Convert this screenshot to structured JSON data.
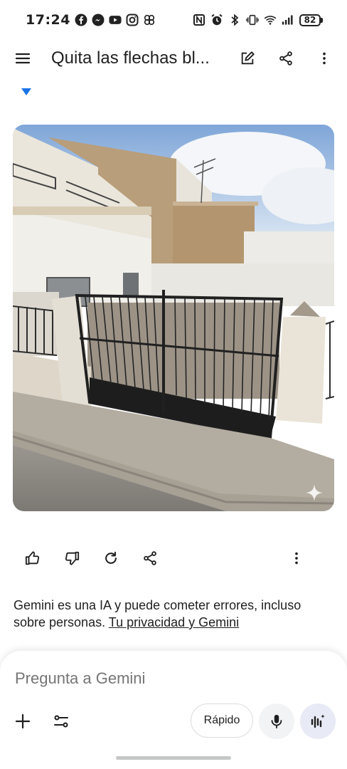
{
  "status_bar": {
    "time": "17:24",
    "battery": "82",
    "left_icons": [
      "facebook-icon",
      "messenger-icon",
      "youtube-icon",
      "instagram-icon",
      "pinwheel-icon"
    ],
    "right_icons": [
      "nfc-icon",
      "alarm-icon",
      "bluetooth-icon",
      "vibrate-icon",
      "wifi-icon",
      "signal-icon"
    ]
  },
  "app_bar": {
    "title": "Quita las flechas bl...",
    "menu_icon": "menu-icon",
    "edit_icon": "edit-icon",
    "share_icon": "share-icon",
    "more_icon": "more-vert-icon"
  },
  "response": {
    "image_description_icon": "sparkle-icon",
    "actions": [
      "thumb-up-icon",
      "thumb-down-icon",
      "regenerate-icon",
      "share-icon",
      "more-vert-icon"
    ]
  },
  "disclaimer": {
    "text": "Gemini es una IA y puede cometer errores, incluso sobre personas. ",
    "link": "Tu privacidad y Gemini"
  },
  "composer": {
    "placeholder": "Pregunta a Gemini",
    "mode": "Rápido"
  },
  "colors": {
    "accent": "#1a73e8",
    "text": "#1f1f1f",
    "placeholder": "#5f6368"
  }
}
